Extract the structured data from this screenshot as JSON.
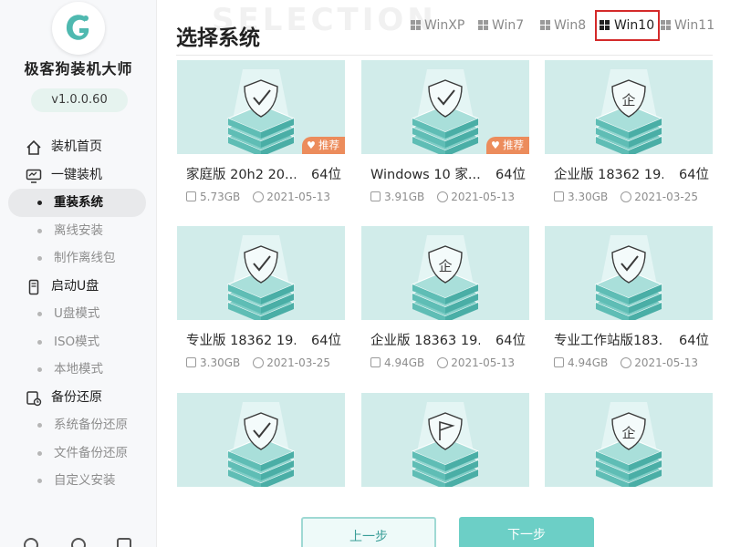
{
  "app": {
    "name": "极客狗装机大师",
    "version": "v1.0.0.60"
  },
  "nav": {
    "groups": [
      {
        "label": "装机首页",
        "icon": "home-icon",
        "items": []
      },
      {
        "label": "一键装机",
        "icon": "monitor-icon",
        "items": [
          {
            "label": "重装系统",
            "active": true
          },
          {
            "label": "离线安装",
            "active": false
          },
          {
            "label": "制作离线包",
            "active": false
          }
        ]
      },
      {
        "label": "启动U盘",
        "icon": "usb-icon",
        "items": [
          {
            "label": "U盘模式",
            "active": false
          },
          {
            "label": "ISO模式",
            "active": false
          },
          {
            "label": "本地模式",
            "active": false
          }
        ]
      },
      {
        "label": "备份还原",
        "icon": "backup-icon",
        "items": [
          {
            "label": "系统备份还原",
            "active": false
          },
          {
            "label": "文件备份还原",
            "active": false
          },
          {
            "label": "自定义安装",
            "active": false
          }
        ]
      }
    ]
  },
  "main": {
    "title": "选择系统",
    "watermark": "SELECTION",
    "os_tabs": [
      {
        "label": "WinXP",
        "active": false
      },
      {
        "label": "Win7",
        "active": false
      },
      {
        "label": "Win8",
        "active": false
      },
      {
        "label": "Win10",
        "active": true
      },
      {
        "label": "Win11",
        "active": false
      }
    ],
    "systems": [
      {
        "name": "家庭版 20h2 20...",
        "bits": "64位",
        "size": "5.73GB",
        "date": "2021-05-13",
        "badge": "推荐",
        "icon": "check-shield"
      },
      {
        "name": "Windows 10 家...",
        "bits": "64位",
        "size": "3.91GB",
        "date": "2021-05-13",
        "badge": "推荐",
        "icon": "check-shield"
      },
      {
        "name": "企业版 18362 19...",
        "bits": "64位",
        "size": "3.30GB",
        "date": "2021-03-25",
        "badge": "",
        "icon": "enterprise-shield"
      },
      {
        "name": "专业版 18362 19...",
        "bits": "64位",
        "size": "3.30GB",
        "date": "2021-03-25",
        "badge": "",
        "icon": "check-shield"
      },
      {
        "name": "企业版 18363 19...",
        "bits": "64位",
        "size": "4.94GB",
        "date": "2021-05-13",
        "badge": "",
        "icon": "enterprise-shield"
      },
      {
        "name": "专业工作站版183...",
        "bits": "64位",
        "size": "4.94GB",
        "date": "2021-05-13",
        "badge": "",
        "icon": "check-shield"
      },
      {
        "name": "",
        "bits": "",
        "size": "",
        "date": "",
        "badge": "",
        "icon": "check-shield"
      },
      {
        "name": "",
        "bits": "",
        "size": "",
        "date": "",
        "badge": "",
        "icon": "flag-shield"
      },
      {
        "name": "",
        "bits": "",
        "size": "",
        "date": "",
        "badge": "",
        "icon": "enterprise-shield"
      }
    ],
    "buttons": {
      "prev": "上一步",
      "next": "下一步"
    }
  },
  "colors": {
    "accent": "#6ccfc6",
    "tab_highlight": "#d42a2a",
    "badge": "#ec8c5c"
  }
}
